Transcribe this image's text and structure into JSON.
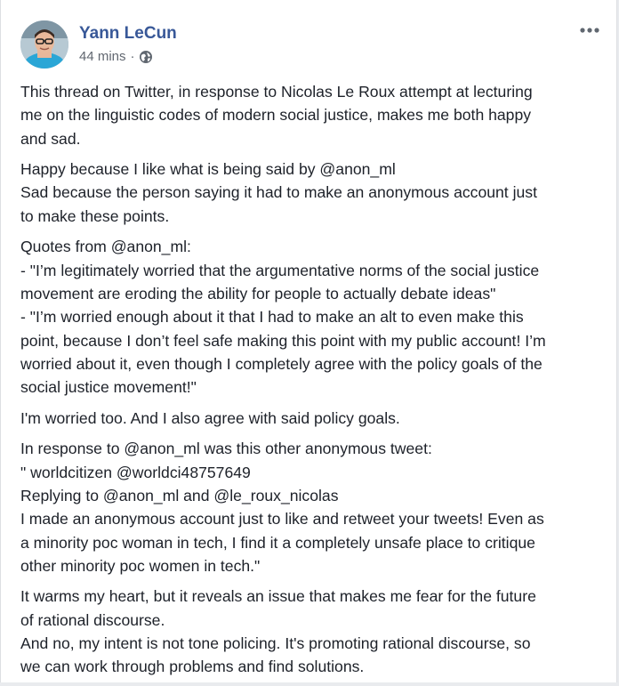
{
  "post": {
    "author": "Yann LeCun",
    "time": "44 mins",
    "separator": "·",
    "privacy_icon": "globe-icon",
    "more_icon": "more-options-icon",
    "paragraphs": [
      [
        "This thread on Twitter, in response to Nicolas Le Roux attempt at lecturing",
        "me on the linguistic codes of modern social justice, makes me both happy",
        "and sad."
      ],
      [
        "Happy because I like what is being said by @anon_ml",
        "Sad because the person saying it had to make an anonymous account just",
        "to make these points."
      ],
      [
        "Quotes from @anon_ml:",
        "- \"I’m legitimately worried that the argumentative norms of the social justice",
        "movement are eroding the ability for people to actually debate ideas\"",
        "- \"I’m worried enough about it that I had to make an alt to even make this",
        "point, because I don’t feel safe making this point with my public account! I’m",
        "worried about it, even though I completely agree with the policy goals of the",
        "social justice movement!\""
      ],
      [
        "I'm worried too. And I also agree with said policy goals."
      ],
      [
        "In response to @anon_ml was this other anonymous tweet:",
        "\" worldcitizen @worldci48757649",
        "Replying to @anon_ml and @le_roux_nicolas",
        "I made an anonymous account just to like and retweet your tweets! Even as",
        "a minority poc woman in tech, I find it a completely unsafe place to critique",
        "other minority poc women in tech.\""
      ],
      [
        "It warms my heart, but it reveals an issue that makes me fear for the future",
        "of rational discourse.",
        "And no, my intent is not tone policing. It's promoting rational discourse, so",
        "we can work through problems and find solutions."
      ]
    ]
  }
}
